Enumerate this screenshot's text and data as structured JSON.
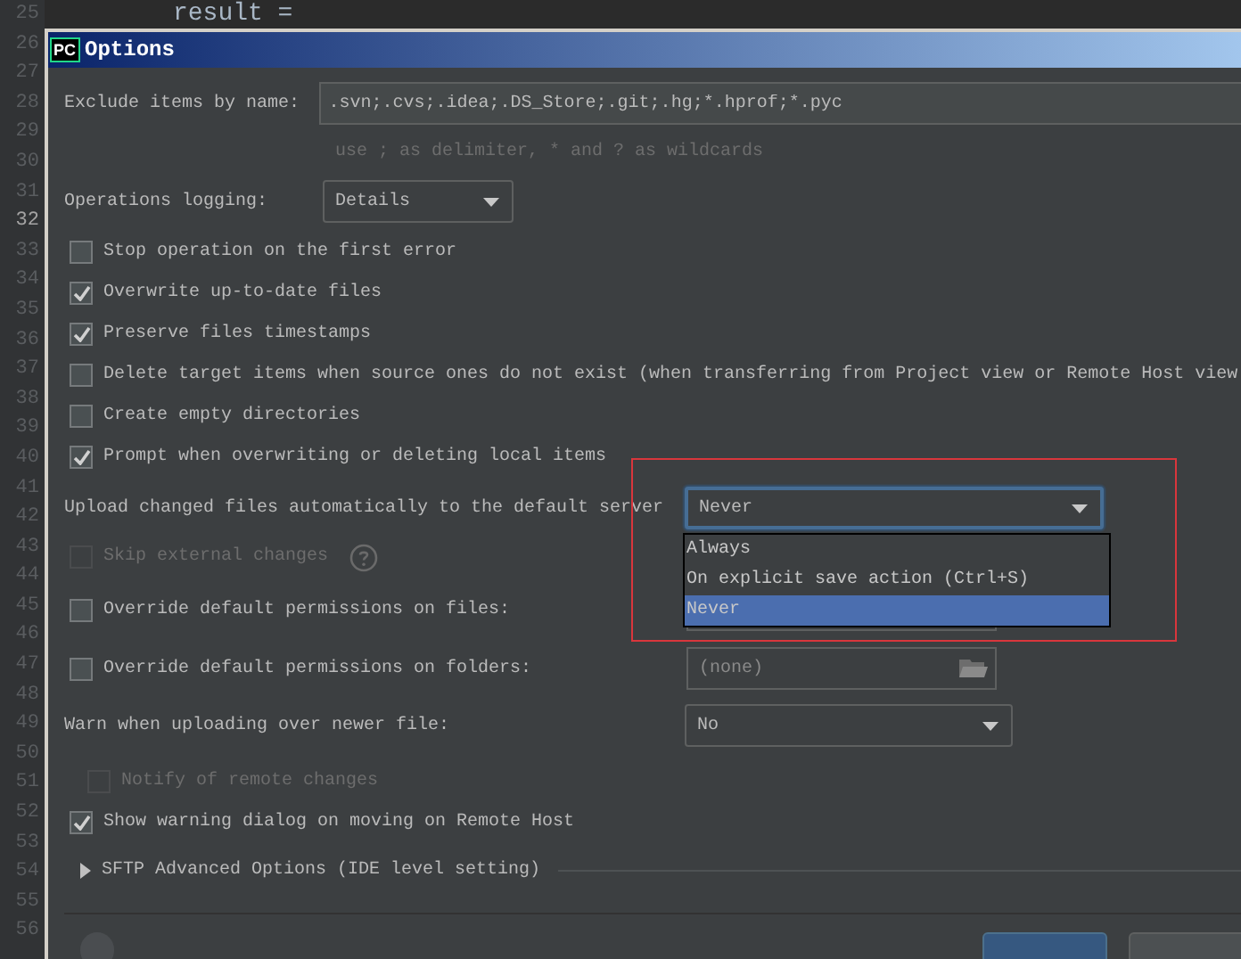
{
  "editor": {
    "code_line": "result =",
    "lines": [
      {
        "number": "25",
        "current": false
      },
      {
        "number": "26",
        "current": false
      },
      {
        "number": "27",
        "current": false
      },
      {
        "number": "28",
        "current": false
      },
      {
        "number": "29",
        "current": false
      },
      {
        "number": "30",
        "current": false
      },
      {
        "number": "31",
        "current": false
      },
      {
        "number": "32",
        "current": true
      },
      {
        "number": "33",
        "current": false
      },
      {
        "number": "34",
        "current": false
      },
      {
        "number": "35",
        "current": false
      },
      {
        "number": "36",
        "current": false
      },
      {
        "number": "37",
        "current": false
      },
      {
        "number": "38",
        "current": false
      },
      {
        "number": "39",
        "current": false
      },
      {
        "number": "40",
        "current": false
      },
      {
        "number": "41",
        "current": false
      },
      {
        "number": "42",
        "current": false
      },
      {
        "number": "43",
        "current": false
      },
      {
        "number": "44",
        "current": false
      },
      {
        "number": "45",
        "current": false
      },
      {
        "number": "46",
        "current": false
      },
      {
        "number": "47",
        "current": false
      },
      {
        "number": "48",
        "current": false
      },
      {
        "number": "49",
        "current": false
      },
      {
        "number": "50",
        "current": false
      },
      {
        "number": "51",
        "current": false
      },
      {
        "number": "52",
        "current": false
      },
      {
        "number": "53",
        "current": false
      },
      {
        "number": "54",
        "current": false
      },
      {
        "number": "55",
        "current": false
      },
      {
        "number": "56",
        "current": false
      }
    ]
  },
  "dialog": {
    "title": "Options",
    "app_icon": "PC",
    "exclude": {
      "label": "Exclude items by name:",
      "value": ".svn;.cvs;.idea;.DS_Store;.git;.hg;*.hprof;*.pyc",
      "hint": "use ; as delimiter, * and ? as wildcards"
    },
    "logging": {
      "label": "Operations logging:",
      "value": "Details"
    },
    "rows": [
      {
        "kind": "checkbox",
        "label": "Stop operation on the first error",
        "checked": false,
        "disabled": false
      },
      {
        "kind": "checkbox",
        "label": "Overwrite up-to-date files",
        "checked": true,
        "disabled": false
      },
      {
        "kind": "checkbox",
        "label": "Preserve files timestamps",
        "checked": true,
        "disabled": false
      },
      {
        "kind": "checkbox",
        "label": "Delete target items when source ones do not exist (when transferring from Project view or Remote Host view",
        "checked": false,
        "disabled": false
      },
      {
        "kind": "checkbox",
        "label": "Create empty directories",
        "checked": false,
        "disabled": false
      },
      {
        "kind": "checkbox",
        "label": "Prompt when overwriting or deleting local items",
        "checked": true,
        "disabled": false
      },
      {
        "kind": "select",
        "label": "Upload changed files automatically to the default server",
        "value": "Never",
        "open": true,
        "menu_items": [
          {
            "label": "Always",
            "selected": false
          },
          {
            "label": "On explicit save action (Ctrl+S)",
            "selected": false
          },
          {
            "label": "Never",
            "selected": true
          }
        ]
      },
      {
        "kind": "checkbox",
        "label": "Skip external changes",
        "checked": false,
        "disabled": true,
        "help": true
      },
      {
        "kind": "path",
        "label": "Override default permissions on files:",
        "checked": false
      },
      {
        "kind": "path",
        "label": "Override default permissions on folders:",
        "checked": false,
        "placeholder": "(none)"
      },
      {
        "kind": "select",
        "label": "Warn when uploading over newer file:",
        "value": "No",
        "open": false,
        "children": [
          {
            "kind": "checkbox",
            "label": "Notify of remote changes",
            "checked": false,
            "disabled": true
          }
        ]
      },
      {
        "kind": "checkbox",
        "label": "Show warning dialog on moving on Remote Host",
        "checked": true,
        "disabled": false
      },
      {
        "kind": "expander",
        "label": "SFTP Advanced Options (IDE level setting)",
        "expanded": false
      }
    ]
  }
}
